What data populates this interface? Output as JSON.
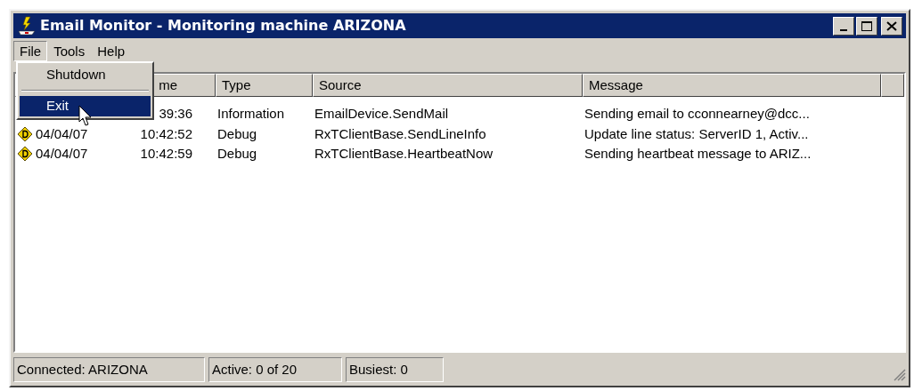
{
  "window": {
    "title": "Email Monitor - Monitoring machine ARIZONA"
  },
  "menu_bar": [
    {
      "label": "File",
      "selected": true
    },
    {
      "label": "Tools",
      "selected": false
    },
    {
      "label": "Help",
      "selected": false
    }
  ],
  "file_menu": [
    {
      "kind": "item",
      "label": "Shutdown",
      "selected": false
    },
    {
      "kind": "separator"
    },
    {
      "kind": "item",
      "label": "Exit",
      "selected": true
    }
  ],
  "table": {
    "columns": [
      "me",
      "Type",
      "Source",
      "Message"
    ],
    "rows": [
      {
        "time": "39:36",
        "type": "Information",
        "source": "EmailDevice.SendMail",
        "message": "Sending email to cconnearney@dcc..."
      },
      {
        "kind": "debug",
        "date": "04/04/07",
        "time": "10:42:52",
        "type": "Debug",
        "source": "RxTClientBase.SendLineInfo",
        "message": "Update line status: ServerID 1, Activ..."
      },
      {
        "kind": "debug",
        "date": "04/04/07",
        "time": "10:42:59",
        "type": "Debug",
        "source": "RxTClientBase.HeartbeatNow",
        "message": "Sending heartbeat message to ARIZ..."
      }
    ]
  },
  "status_bar": [
    "Connected: ARIZONA",
    "Active: 0 of 20",
    "Busiest: 0"
  ]
}
